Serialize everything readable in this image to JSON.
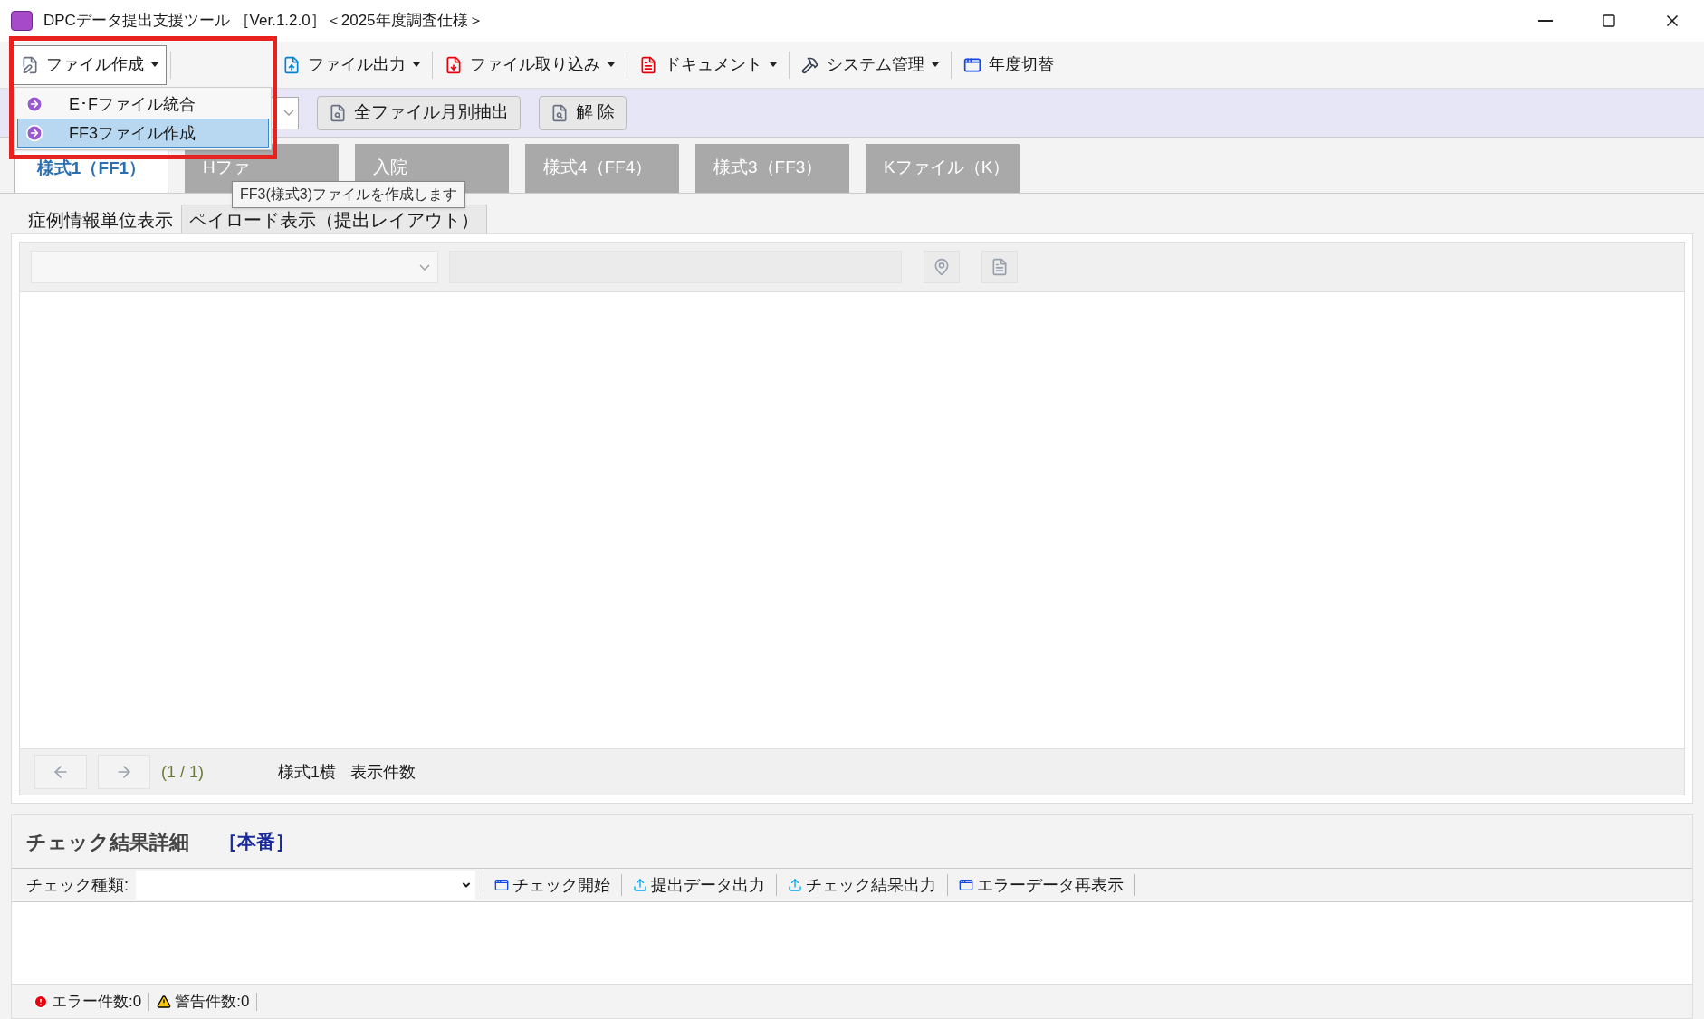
{
  "window": {
    "title": "DPCデータ提出支援ツール ［Ver.1.2.0］＜2025年度調査仕様＞"
  },
  "menu": [
    {
      "label": "ファイル作成",
      "kind": "file-new",
      "dropdown": true,
      "open": true
    },
    {
      "label": "ファイル出力",
      "kind": "upload",
      "dropdown": true,
      "open": false
    },
    {
      "label": "ファイル取り込み",
      "kind": "download",
      "dropdown": true,
      "open": false
    },
    {
      "label": "ドキュメント",
      "kind": "pdf",
      "dropdown": true,
      "open": false
    },
    {
      "label": "システム管理",
      "kind": "hammer",
      "dropdown": true,
      "open": false
    },
    {
      "label": "年度切替",
      "kind": "window",
      "dropdown": false,
      "open": false
    }
  ],
  "dropdown_menu": [
    {
      "label": "E･Fファイル統合",
      "selected": false
    },
    {
      "label": "FF3ファイル作成",
      "selected": true
    }
  ],
  "tooltip": "FF3(様式3)ファイルを作成します",
  "sub_toolbar": {
    "buttons": [
      "全ファイル月別抽出",
      "解 除"
    ]
  },
  "main_tabs": [
    {
      "label": "様式1（FF1）",
      "selected": true
    },
    {
      "label": "Hファ",
      "selected": false
    },
    {
      "label": "入院",
      "selected": false
    },
    {
      "label": "様式4（FF4）",
      "selected": false
    },
    {
      "label": "様式3（FF3）",
      "selected": false
    },
    {
      "label": "Kファイル（K）",
      "selected": false
    }
  ],
  "view_tabs": [
    {
      "label": "症例情報単位表示",
      "selected": true
    },
    {
      "label": "ペイロード表示（提出レイアウト）",
      "selected": false
    }
  ],
  "pager": {
    "page": "(1 / 1)",
    "layout_label": "様式1横",
    "count_label": "表示件数"
  },
  "check": {
    "title": "チェック結果詳細",
    "mode": "［本番］",
    "type_label": "チェック種類:",
    "actions": [
      {
        "label": "チェック開始",
        "kind": "window"
      },
      {
        "label": "提出データ出力",
        "kind": "upload"
      },
      {
        "label": "チェック結果出力",
        "kind": "upload"
      },
      {
        "label": "エラーデータ再表示",
        "kind": "window"
      }
    ],
    "status": [
      {
        "kind": "error",
        "text": "エラー件数:0"
      },
      {
        "kind": "warning",
        "text": "警告件数:0"
      }
    ]
  }
}
